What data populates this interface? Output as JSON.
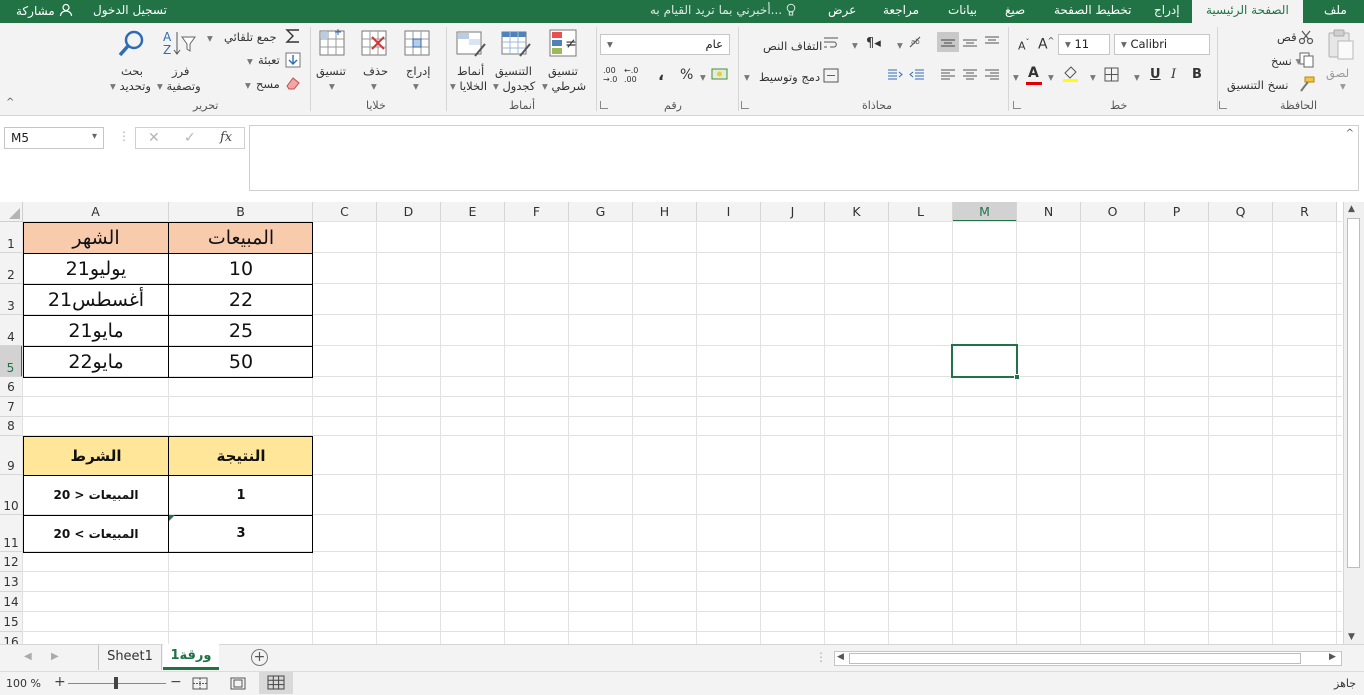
{
  "tabs": {
    "file": "ملف",
    "home": "الصفحة الرئيسية",
    "insert": "إدراج",
    "page_layout": "تخطيط الصفحة",
    "formulas": "صيغ",
    "data": "بيانات",
    "review": "مراجعة",
    "view": "عرض",
    "tell_me": "أخبرني بما تريد القيام به...",
    "sign_in": "تسجيل الدخول",
    "share": "مشاركة"
  },
  "clipboard": {
    "paste": "لصق",
    "cut": "قص",
    "copy": "نسخ",
    "format_painter": "نسخ التنسيق",
    "group": "الحافظة"
  },
  "font": {
    "name": "Calibri",
    "size": "11",
    "bold": "B",
    "italic": "I",
    "underline": "U",
    "group": "خط"
  },
  "alignment": {
    "wrap_text": "التفاف النص",
    "merge_center": "دمج وتوسيط",
    "group": "محاذاة"
  },
  "number": {
    "format": "عام",
    "percent": "%",
    "comma": "،",
    "group": "رقم"
  },
  "styles": {
    "conditional": [
      "تنسيق",
      "شرطي"
    ],
    "format_table": [
      "التنسيق",
      "كجدول"
    ],
    "cell_styles": [
      "أنماط",
      "الخلايا"
    ],
    "group": "أنماط"
  },
  "cells": {
    "insert": "إدراج",
    "delete": "حذف",
    "format": "تنسيق",
    "group": "خلايا"
  },
  "editing": {
    "autosum": "جمع تلقائي",
    "fill": "تعبئة",
    "clear": "مسح",
    "sort_filter": [
      "فرز",
      "وتصفية"
    ],
    "find_select": [
      "بحث",
      "وتحديد"
    ],
    "group": "تحرير"
  },
  "formula_bar": {
    "name_box": "M5",
    "fx": "fx",
    "content": ""
  },
  "columns": [
    "A",
    "B",
    "C",
    "D",
    "E",
    "F",
    "G",
    "H",
    "I",
    "J",
    "K",
    "L",
    "M",
    "N",
    "O",
    "P",
    "Q",
    "R"
  ],
  "rows": [
    "1",
    "2",
    "3",
    "4",
    "5",
    "6",
    "7",
    "8",
    "9",
    "10",
    "11",
    "12",
    "13",
    "14",
    "15",
    "16"
  ],
  "table1": {
    "header_month": "الشهر",
    "header_sales": "المبيعات",
    "months": [
      "يوليو21",
      "أغسطس21",
      "مايو21",
      "مايو22"
    ],
    "sales": [
      "10",
      "22",
      "25",
      "50"
    ]
  },
  "table2": {
    "header_condition": "الشرط",
    "header_result": "النتيجة",
    "conditions": [
      "المبيعات < 20",
      "المبيعات > 20"
    ],
    "results": [
      "1",
      "3"
    ]
  },
  "sheets": {
    "sheet1": "Sheet1",
    "sheet2": "ورقة1"
  },
  "status": {
    "ready": "جاهز",
    "zoom": "100 %"
  },
  "colors": {
    "accent": "#217346",
    "header_orange": "#f8cbad",
    "header_yellow": "#ffe699",
    "selection": "#217346"
  }
}
